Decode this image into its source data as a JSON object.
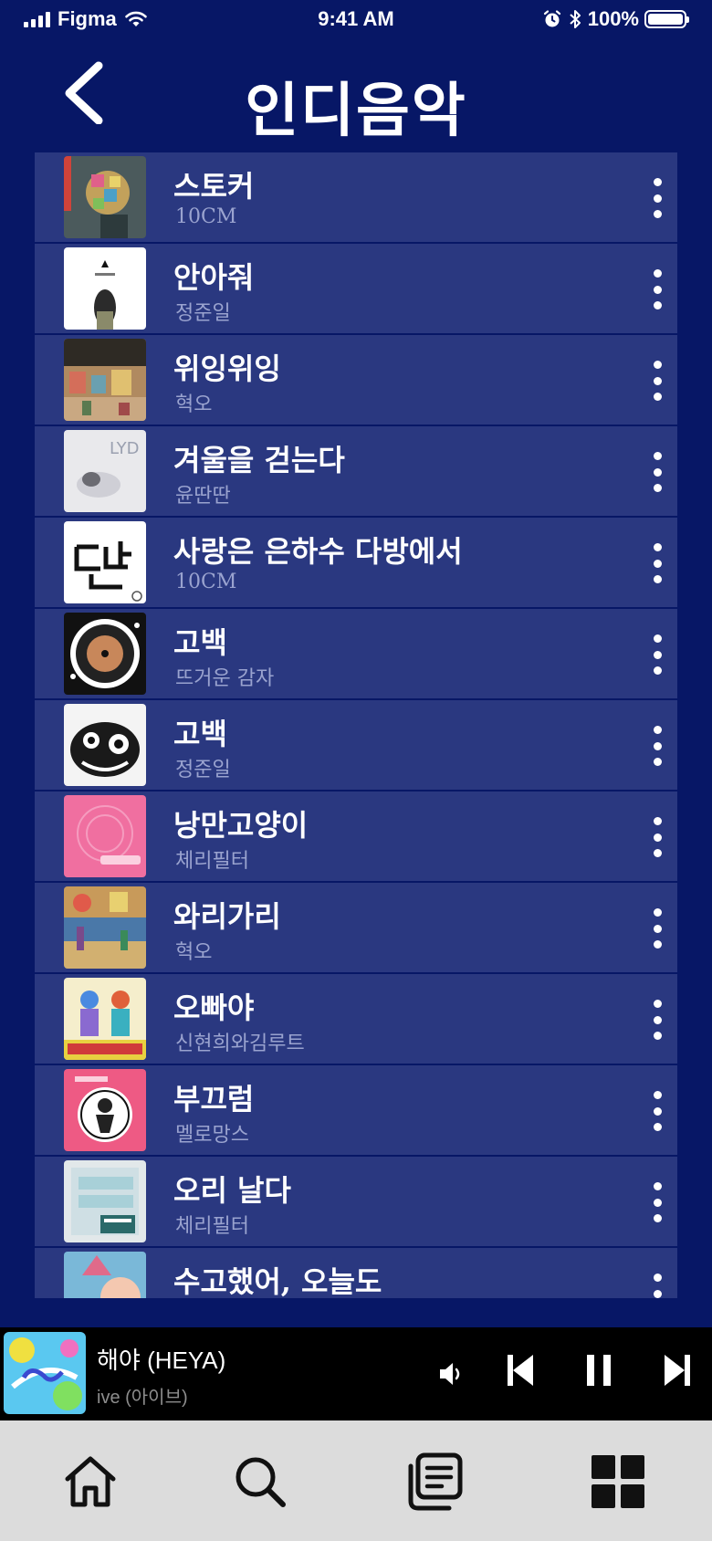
{
  "status_bar": {
    "carrier": "Figma",
    "time": "9:41 AM",
    "battery": "100%"
  },
  "header": {
    "title": "인디음악"
  },
  "tracks": [
    {
      "title": "스토커",
      "artist": "10CM"
    },
    {
      "title": "안아줘",
      "artist": "정준일"
    },
    {
      "title": "위잉위잉",
      "artist": "혁오"
    },
    {
      "title": "겨울을 걷는다",
      "artist": "윤딴딴"
    },
    {
      "title": "사랑은 은하수 다방에서",
      "artist": "10CM"
    },
    {
      "title": "고백",
      "artist": "뜨거운 감자"
    },
    {
      "title": "고백",
      "artist": "정준일"
    },
    {
      "title": "낭만고양이",
      "artist": "체리필터"
    },
    {
      "title": "와리가리",
      "artist": "혁오"
    },
    {
      "title": "오빠야",
      "artist": "신현희와김루트"
    },
    {
      "title": "부끄럼",
      "artist": "멜로망스"
    },
    {
      "title": "오리 날다",
      "artist": "체리필터"
    },
    {
      "title": "수고했어, 오늘도",
      "artist": ""
    }
  ],
  "now_playing": {
    "title": "해야 (HEYA)",
    "artist": "ive (아이브)"
  },
  "colors": {
    "background": "#071766",
    "row": "#2a3880",
    "artist_text": "#9aa3cf",
    "player": "#000000",
    "tab_bar": "#dcdcdc"
  },
  "icons": [
    "back-icon",
    "more-icon",
    "volume-icon",
    "previous-icon",
    "pause-icon",
    "next-icon",
    "home-icon",
    "search-icon",
    "library-icon",
    "grid-icon"
  ]
}
